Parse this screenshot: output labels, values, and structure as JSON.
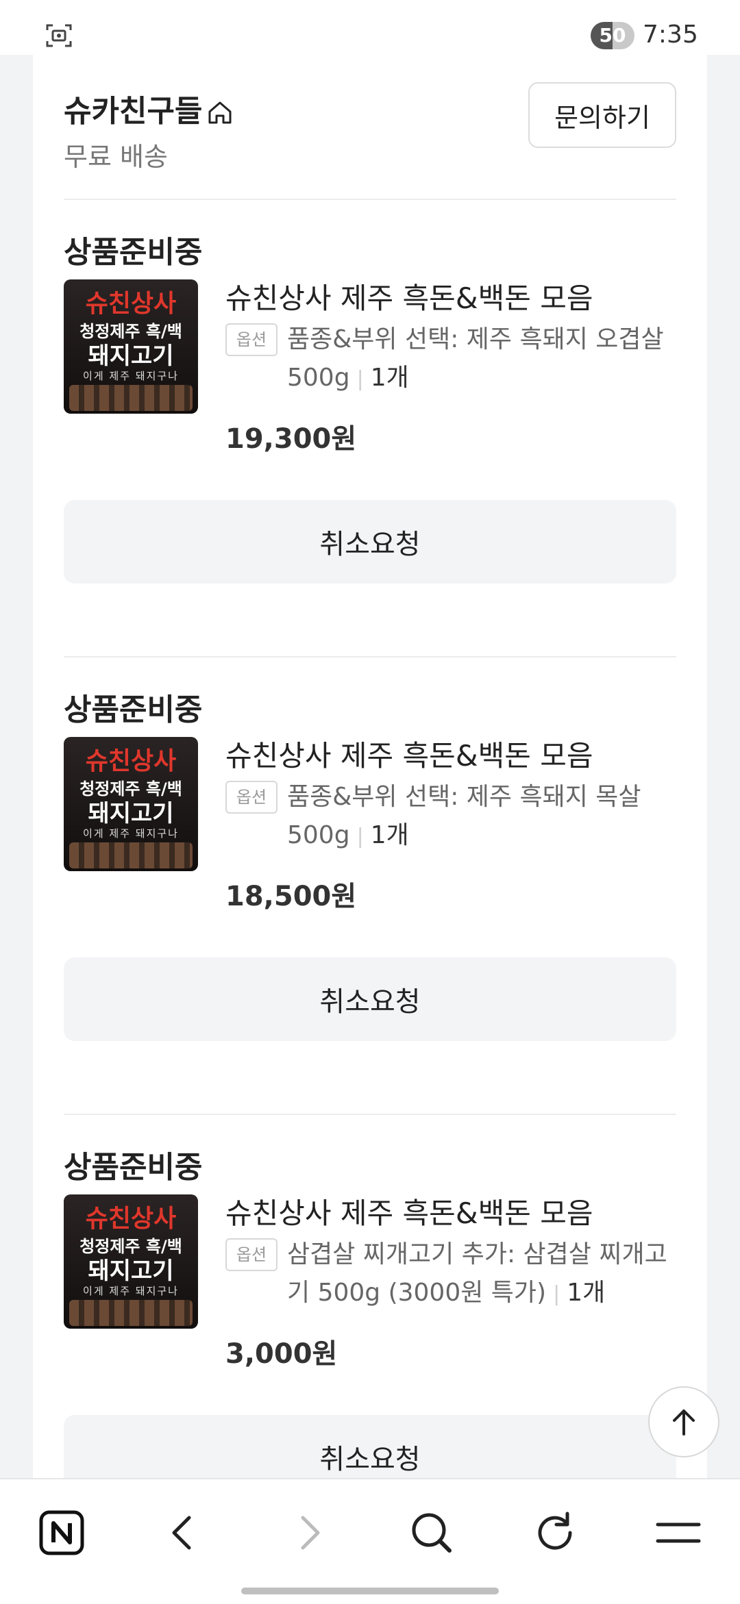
{
  "status_bar": {
    "battery_level": "50",
    "time": "7:35",
    "left_icon": "screen-capture-icon"
  },
  "seller": {
    "name": "슈카친구들",
    "shipping": "무료 배송",
    "inquiry_label": "문의하기",
    "home_icon": "home-icon"
  },
  "orders": [
    {
      "status": "상품준비중",
      "thumb": {
        "line1": "슈친상사",
        "line2": "청정제주 흑/백",
        "line3": "돼지고기",
        "line4": "이게 제주 돼지구나"
      },
      "product_name": "슈친상사 제주 흑돈&백돈 모음",
      "option_label": "옵션",
      "option_text": "품종&부위 선택: 제주 흑돼지 오겹살 500g",
      "quantity": "1개",
      "price": "19,300원",
      "cancel_label": "취소요청"
    },
    {
      "status": "상품준비중",
      "thumb": {
        "line1": "슈친상사",
        "line2": "청정제주 흑/백",
        "line3": "돼지고기",
        "line4": "이게 제주 돼지구나"
      },
      "product_name": "슈친상사 제주 흑돈&백돈 모음",
      "option_label": "옵션",
      "option_text": "품종&부위 선택: 제주 흑돼지 목살 500g",
      "quantity": "1개",
      "price": "18,500원",
      "cancel_label": "취소요청"
    },
    {
      "status": "상품준비중",
      "thumb": {
        "line1": "슈친상사",
        "line2": "청정제주 흑/백",
        "line3": "돼지고기",
        "line4": "이게 제주 돼지구나"
      },
      "product_name": "슈친상사 제주 흑돈&백돈 모음",
      "option_label": "옵션",
      "option_text": "삼겹살 찌개고기 추가: 삼겹살 찌개고기 500g (3000원 특가)",
      "quantity": "1개",
      "price": "3,000원",
      "cancel_label": "취소요청"
    }
  ],
  "scroll_top_icon": "arrow-up-icon",
  "bottom_nav": {
    "items": [
      "naver-home-icon",
      "back-icon",
      "forward-icon",
      "search-icon",
      "refresh-icon",
      "menu-icon"
    ]
  }
}
